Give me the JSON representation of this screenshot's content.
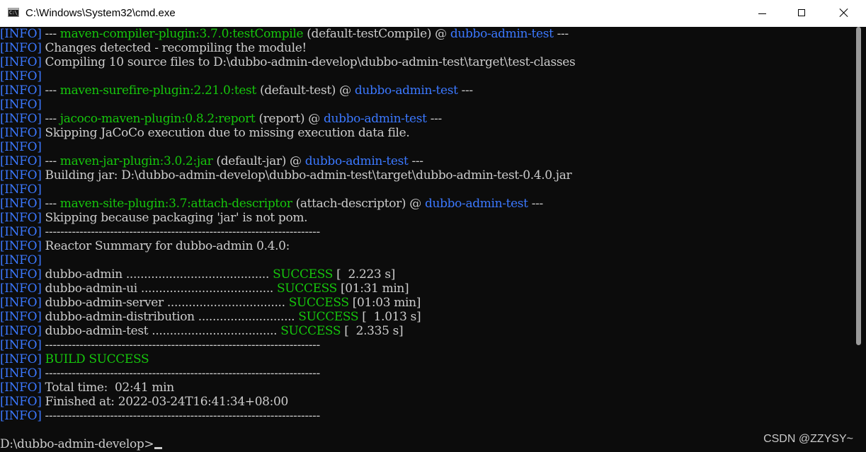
{
  "window": {
    "title": "C:\\Windows\\System32\\cmd.exe",
    "icon": "cmd-icon",
    "icon_glyph": "C:\\_",
    "controls": {
      "minimize": "minimize-icon",
      "maximize": "maximize-icon",
      "close": "close-icon"
    }
  },
  "colors": {
    "background": "#0c0c0c",
    "text": "#cccccc",
    "info_tag": "#3b78ff",
    "plugin": "#16c60c",
    "project": "#3b78ff",
    "success": "#16c60c"
  },
  "console": {
    "lines": [
      {
        "tag": "[INFO]",
        "segments": [
          {
            "t": " --- ",
            "c": "text"
          },
          {
            "t": "maven-compiler-plugin:3.7.0:testCompile",
            "c": "plugin"
          },
          {
            "t": " (default-testCompile) @ ",
            "c": "text"
          },
          {
            "t": "dubbo-admin-test",
            "c": "project"
          },
          {
            "t": " ---",
            "c": "text"
          }
        ]
      },
      {
        "tag": "[INFO]",
        "segments": [
          {
            "t": " Changes detected - recompiling the module!",
            "c": "text"
          }
        ]
      },
      {
        "tag": "[INFO]",
        "segments": [
          {
            "t": " Compiling 10 source files to D:\\dubbo-admin-develop\\dubbo-admin-test\\target\\test-classes",
            "c": "text"
          }
        ]
      },
      {
        "tag": "[INFO]",
        "segments": []
      },
      {
        "tag": "[INFO]",
        "segments": [
          {
            "t": " --- ",
            "c": "text"
          },
          {
            "t": "maven-surefire-plugin:2.21.0:test",
            "c": "plugin"
          },
          {
            "t": " (default-test) @ ",
            "c": "text"
          },
          {
            "t": "dubbo-admin-test",
            "c": "project"
          },
          {
            "t": " ---",
            "c": "text"
          }
        ]
      },
      {
        "tag": "[INFO]",
        "segments": []
      },
      {
        "tag": "[INFO]",
        "segments": [
          {
            "t": " --- ",
            "c": "text"
          },
          {
            "t": "jacoco-maven-plugin:0.8.2:report",
            "c": "plugin"
          },
          {
            "t": " (report) @ ",
            "c": "text"
          },
          {
            "t": "dubbo-admin-test",
            "c": "project"
          },
          {
            "t": " ---",
            "c": "text"
          }
        ]
      },
      {
        "tag": "[INFO]",
        "segments": [
          {
            "t": " Skipping JaCoCo execution due to missing execution data file.",
            "c": "text"
          }
        ]
      },
      {
        "tag": "[INFO]",
        "segments": []
      },
      {
        "tag": "[INFO]",
        "segments": [
          {
            "t": " --- ",
            "c": "text"
          },
          {
            "t": "maven-jar-plugin:3.0.2:jar",
            "c": "plugin"
          },
          {
            "t": " (default-jar) @ ",
            "c": "text"
          },
          {
            "t": "dubbo-admin-test",
            "c": "project"
          },
          {
            "t": " ---",
            "c": "text"
          }
        ]
      },
      {
        "tag": "[INFO]",
        "segments": [
          {
            "t": " Building jar: D:\\dubbo-admin-develop\\dubbo-admin-test\\target\\dubbo-admin-test-0.4.0.jar",
            "c": "text"
          }
        ]
      },
      {
        "tag": "[INFO]",
        "segments": []
      },
      {
        "tag": "[INFO]",
        "segments": [
          {
            "t": " --- ",
            "c": "text"
          },
          {
            "t": "maven-site-plugin:3.7:attach-descriptor",
            "c": "plugin"
          },
          {
            "t": " (attach-descriptor) @ ",
            "c": "text"
          },
          {
            "t": "dubbo-admin-test",
            "c": "project"
          },
          {
            "t": " ---",
            "c": "text"
          }
        ]
      },
      {
        "tag": "[INFO]",
        "segments": [
          {
            "t": " Skipping because packaging 'jar' is not pom.",
            "c": "text"
          }
        ]
      },
      {
        "tag": "[INFO]",
        "segments": [
          {
            "t": " ------------------------------------------------------------------------",
            "c": "text"
          }
        ]
      },
      {
        "tag": "[INFO]",
        "segments": [
          {
            "t": " Reactor Summary for dubbo-admin 0.4.0:",
            "c": "text"
          }
        ]
      },
      {
        "tag": "[INFO]",
        "segments": []
      },
      {
        "tag": "[INFO]",
        "segments": [
          {
            "t": " dubbo-admin ........................................ ",
            "c": "text"
          },
          {
            "t": "SUCCESS",
            "c": "success"
          },
          {
            "t": " [  2.223 s]",
            "c": "text"
          }
        ]
      },
      {
        "tag": "[INFO]",
        "segments": [
          {
            "t": " dubbo-admin-ui ..................................... ",
            "c": "text"
          },
          {
            "t": "SUCCESS",
            "c": "success"
          },
          {
            "t": " [01:31 min]",
            "c": "text"
          }
        ]
      },
      {
        "tag": "[INFO]",
        "segments": [
          {
            "t": " dubbo-admin-server ................................. ",
            "c": "text"
          },
          {
            "t": "SUCCESS",
            "c": "success"
          },
          {
            "t": " [01:03 min]",
            "c": "text"
          }
        ]
      },
      {
        "tag": "[INFO]",
        "segments": [
          {
            "t": " dubbo-admin-distribution ........................... ",
            "c": "text"
          },
          {
            "t": "SUCCESS",
            "c": "success"
          },
          {
            "t": " [  1.013 s]",
            "c": "text"
          }
        ]
      },
      {
        "tag": "[INFO]",
        "segments": [
          {
            "t": " dubbo-admin-test ................................... ",
            "c": "text"
          },
          {
            "t": "SUCCESS",
            "c": "success"
          },
          {
            "t": " [  2.335 s]",
            "c": "text"
          }
        ]
      },
      {
        "tag": "[INFO]",
        "segments": [
          {
            "t": " ------------------------------------------------------------------------",
            "c": "text"
          }
        ]
      },
      {
        "tag": "[INFO]",
        "segments": [
          {
            "t": " ",
            "c": "text"
          },
          {
            "t": "BUILD SUCCESS",
            "c": "success"
          }
        ]
      },
      {
        "tag": "[INFO]",
        "segments": [
          {
            "t": " ------------------------------------------------------------------------",
            "c": "text"
          }
        ]
      },
      {
        "tag": "[INFO]",
        "segments": [
          {
            "t": " Total time:  02:41 min",
            "c": "text"
          }
        ]
      },
      {
        "tag": "[INFO]",
        "segments": [
          {
            "t": " Finished at: 2022-03-24T16:41:34+08:00",
            "c": "text"
          }
        ]
      },
      {
        "tag": "[INFO]",
        "segments": [
          {
            "t": " ------------------------------------------------------------------------",
            "c": "text"
          }
        ]
      },
      {
        "tag": "",
        "segments": []
      },
      {
        "tag": "",
        "segments": [
          {
            "t": "D:\\dubbo-admin-develop>",
            "c": "text"
          }
        ],
        "prompt": true
      }
    ]
  },
  "watermark": "CSDN @ZZYSY~"
}
